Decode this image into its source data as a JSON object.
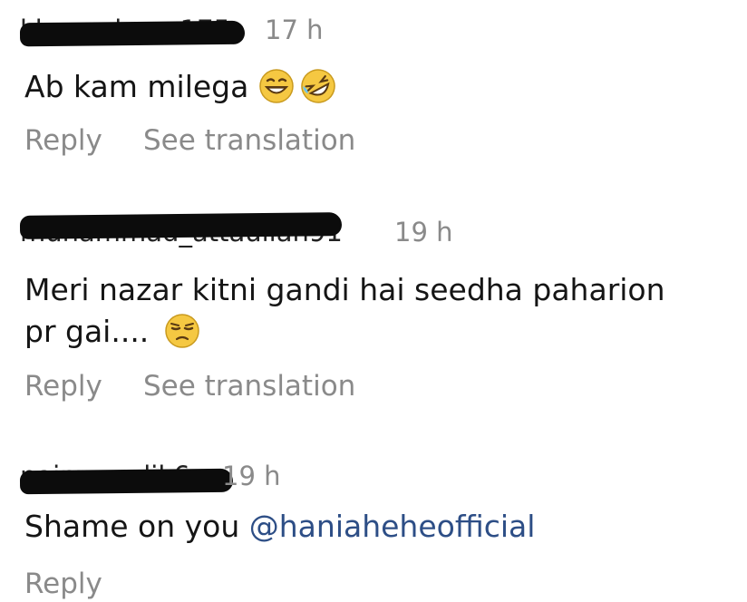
{
  "comments": [
    {
      "username": "khansalman175",
      "time": "17 h",
      "text": "Ab kam milega",
      "emojis": [
        "grinning-squinting-face-emoji",
        "rolling-on-floor-laughing-emoji"
      ],
      "reply_label": "Reply",
      "translate_label": "See translation"
    },
    {
      "username": "muhammad_attaullah91",
      "time": "19 h",
      "text_line1": "Meri nazar kitni gandi hai seedha paharion",
      "text_line2": "pr gai....",
      "emojis": [
        "unamused-face-emoji"
      ],
      "reply_label": "Reply",
      "translate_label": "See translation"
    },
    {
      "username": "naimamalik6",
      "time": "19 h",
      "text": "Shame on you",
      "mention": "@haniaheheofficial",
      "reply_label": "Reply"
    }
  ],
  "colors": {
    "text": "#151515",
    "meta": "#8a8a8a",
    "mention": "#2d4e86",
    "redaction": "#0c0c0c",
    "emoji_yellow": "#f5c842"
  }
}
